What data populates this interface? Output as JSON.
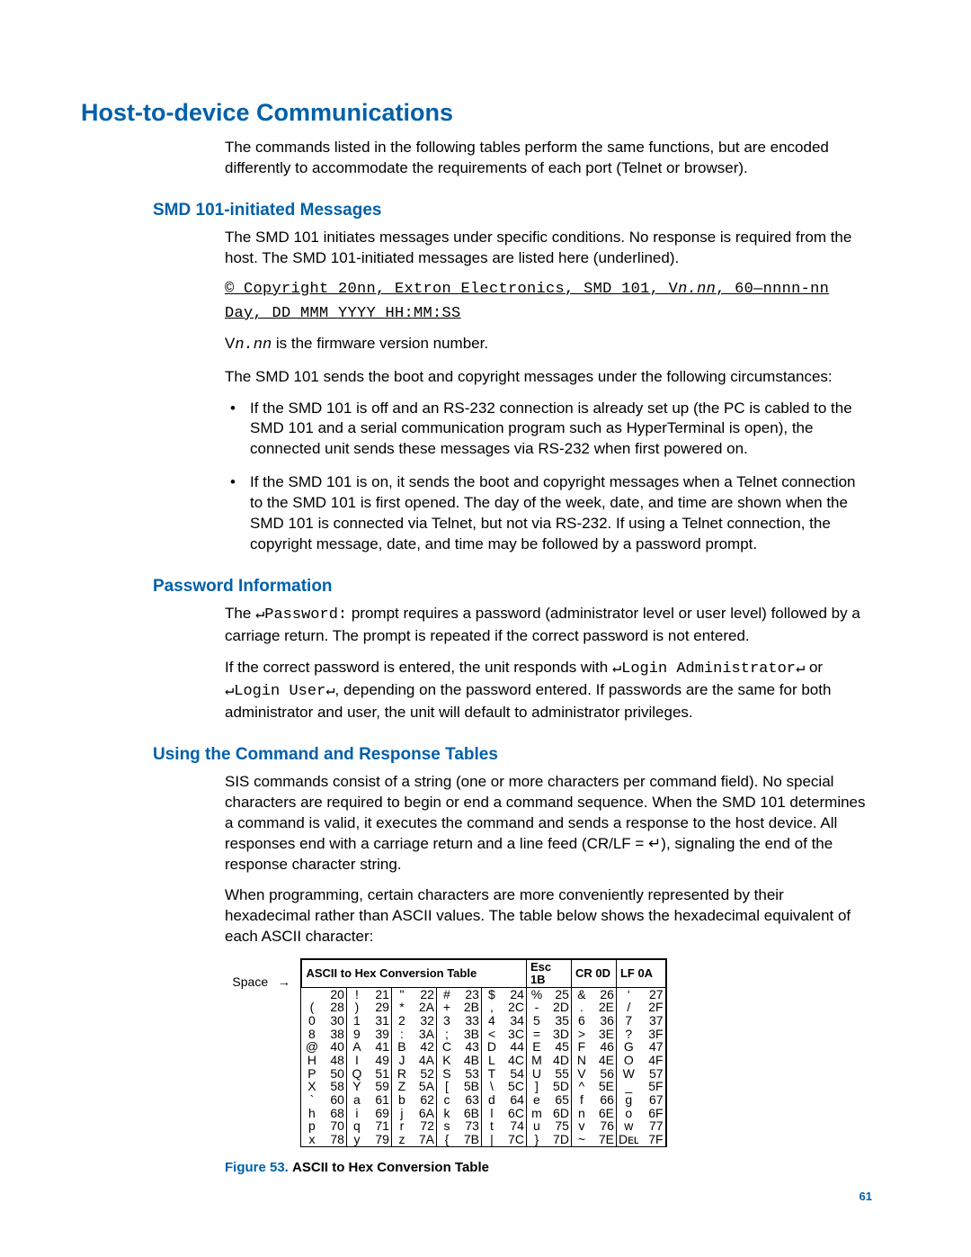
{
  "h1": "Host-to-device Communications",
  "intro": "The commands listed in the following tables perform the same functions, but are encoded differently to accommodate the requirements of each port (Telnet or browser).",
  "sec1": {
    "title": "SMD 101-initiated Messages",
    "p1": "The SMD 101 initiates messages under specific conditions. No response is required from the host. The SMD 101-initiated messages are listed here (underlined).",
    "code1a": "© Copyright 20nn, Extron Electronics, SMD 101, V",
    "code1b": "n.nn",
    "code1c": ", 60—nnnn-nn",
    "code2": "Day, DD MMM YYYY  HH:MM:SS",
    "p2a": "V",
    "p2b": "n.nn",
    "p2c": " is the firmware version number.",
    "p3": "The SMD 101 sends the boot and copyright messages under the following circumstances:",
    "b1": "If the SMD 101 is off and an RS-232 connection is already set up (the PC is cabled to the SMD 101 and a serial communication program such as HyperTerminal is open), the connected unit sends these messages via RS-232 when first powered on.",
    "b2": "If the SMD 101 is on, it sends the boot and copyright messages when a Telnet connection to the SMD 101 is first opened. The day of the week, date, and time are shown when the SMD 101 is connected via Telnet, but not via RS-232. If using a Telnet connection, the copyright message, date, and time may be followed by a password prompt."
  },
  "sec2": {
    "title": "Password Information",
    "p1a": "The ",
    "p1b": "Password:",
    "p1c": " prompt requires a password (administrator level or user level) followed by a carriage return. The prompt is repeated if the correct password is not entered.",
    "p2a": "If the correct password is entered, the unit responds with ",
    "p2b": "Login Administrator",
    "p2c": " or ",
    "p2d": "Login User",
    "p2e": ", depending on the password entered. If passwords are the same for both administrator and user, the unit will default to administrator privileges."
  },
  "sec3": {
    "title": "Using the Command and Response Tables",
    "p1": "SIS commands consist of a string (one or more characters per command field). No special characters are required to begin or end a command sequence. When the SMD 101 determines a command is valid, it executes the command and sends a response to the host device. All responses end with a carriage return and a line feed (CR/LF = ↵), signaling the end of the response character string.",
    "p2": "When programming, certain characters are more conveniently represented by their hexadecimal rather than ASCII values. The table below shows the hexadecimal equivalent of each ASCII character:"
  },
  "table": {
    "title": "ASCII to Hex   Conversion Table",
    "extra": [
      [
        "Esc",
        "1B"
      ],
      [
        "CR",
        "0D"
      ],
      [
        "LF",
        "0A"
      ]
    ],
    "space_label": "Space",
    "rows": [
      [
        [
          "",
          "20"
        ],
        [
          "!",
          "21"
        ],
        [
          "\"",
          "22"
        ],
        [
          "#",
          "23"
        ],
        [
          "$",
          "24"
        ],
        [
          "%",
          "25"
        ],
        [
          "&",
          "26"
        ],
        [
          "‘",
          "27"
        ]
      ],
      [
        [
          "(",
          "28"
        ],
        [
          ")",
          "29"
        ],
        [
          "*",
          "2A"
        ],
        [
          "+",
          "2B"
        ],
        [
          ",",
          "2C"
        ],
        [
          "-",
          "2D"
        ],
        [
          ".",
          "2E"
        ],
        [
          "/",
          "2F"
        ]
      ],
      [
        [
          "0",
          "30"
        ],
        [
          "1",
          "31"
        ],
        [
          "2",
          "32"
        ],
        [
          "3",
          "33"
        ],
        [
          "4",
          "34"
        ],
        [
          "5",
          "35"
        ],
        [
          "6",
          "36"
        ],
        [
          "7",
          "37"
        ]
      ],
      [
        [
          "8",
          "38"
        ],
        [
          "9",
          "39"
        ],
        [
          ":",
          "3A"
        ],
        [
          ";",
          "3B"
        ],
        [
          "<",
          "3C"
        ],
        [
          "=",
          "3D"
        ],
        [
          ">",
          "3E"
        ],
        [
          "?",
          "3F"
        ]
      ],
      [
        [
          "@",
          "40"
        ],
        [
          "A",
          "41"
        ],
        [
          "B",
          "42"
        ],
        [
          "C",
          "43"
        ],
        [
          "D",
          "44"
        ],
        [
          "E",
          "45"
        ],
        [
          "F",
          "46"
        ],
        [
          "G",
          "47"
        ]
      ],
      [
        [
          "H",
          "48"
        ],
        [
          "I",
          "49"
        ],
        [
          "J",
          "4A"
        ],
        [
          "K",
          "4B"
        ],
        [
          "L",
          "4C"
        ],
        [
          "M",
          "4D"
        ],
        [
          "N",
          "4E"
        ],
        [
          "O",
          "4F"
        ]
      ],
      [
        [
          "P",
          "50"
        ],
        [
          "Q",
          "51"
        ],
        [
          "R",
          "52"
        ],
        [
          "S",
          "53"
        ],
        [
          "T",
          "54"
        ],
        [
          "U",
          "55"
        ],
        [
          "V",
          "56"
        ],
        [
          "W",
          "57"
        ]
      ],
      [
        [
          "X",
          "58"
        ],
        [
          "Y",
          "59"
        ],
        [
          "Z",
          "5A"
        ],
        [
          "[",
          "5B"
        ],
        [
          "\\",
          "5C"
        ],
        [
          "]",
          "5D"
        ],
        [
          "^",
          "5E"
        ],
        [
          "_",
          "5F"
        ]
      ],
      [
        [
          "`",
          "60"
        ],
        [
          "a",
          "61"
        ],
        [
          "b",
          "62"
        ],
        [
          "c",
          "63"
        ],
        [
          "d",
          "64"
        ],
        [
          "e",
          "65"
        ],
        [
          "f",
          "66"
        ],
        [
          "g",
          "67"
        ]
      ],
      [
        [
          "h",
          "68"
        ],
        [
          "i",
          "69"
        ],
        [
          "j",
          "6A"
        ],
        [
          "k",
          "6B"
        ],
        [
          "l",
          "6C"
        ],
        [
          "m",
          "6D"
        ],
        [
          "n",
          "6E"
        ],
        [
          "o",
          "6F"
        ]
      ],
      [
        [
          "p",
          "70"
        ],
        [
          "q",
          "71"
        ],
        [
          "r",
          "72"
        ],
        [
          "s",
          "73"
        ],
        [
          "t",
          "74"
        ],
        [
          "u",
          "75"
        ],
        [
          "v",
          "76"
        ],
        [
          "w",
          "77"
        ]
      ],
      [
        [
          "x",
          "78"
        ],
        [
          "y",
          "79"
        ],
        [
          "z",
          "7A"
        ],
        [
          "{",
          "7B"
        ],
        [
          "|",
          "7C"
        ],
        [
          "}",
          "7D"
        ],
        [
          "~",
          "7E"
        ],
        [
          "Dᴇʟ",
          "7F"
        ]
      ]
    ]
  },
  "fig": {
    "num": "Figure 53.",
    "caption": "ASCII to Hex Conversion Table"
  },
  "page_number": "61",
  "return_glyph": "↵"
}
